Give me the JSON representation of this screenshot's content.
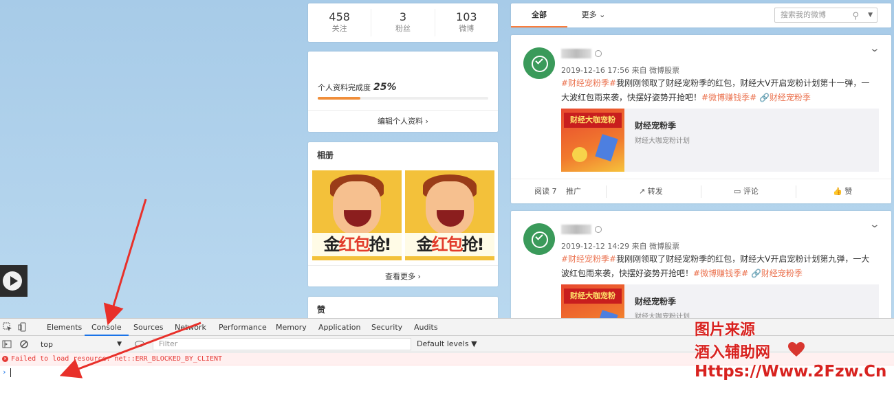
{
  "stats": [
    {
      "value": "458",
      "label": "关注"
    },
    {
      "value": "3",
      "label": "粉丝"
    },
    {
      "value": "103",
      "label": "微博"
    }
  ],
  "profile": {
    "completion_label": "个人资料完成度",
    "completion_value": "25%",
    "completion_fraction": 0.25,
    "edit_link": "编辑个人资料 ›"
  },
  "album": {
    "title": "相册",
    "photo_text_a": "金",
    "photo_text_red": "红包",
    "photo_text_b": "抢!",
    "more_link": "查看更多 ›"
  },
  "likes": {
    "title": "赞"
  },
  "feed": {
    "tabs": {
      "all": "全部",
      "more": "更多 ⌄"
    },
    "search_placeholder": "搜索我的微博",
    "posts": [
      {
        "meta": "2019-12-16 17:56 来自 微博股票",
        "topic1": "#财经宠粉季#",
        "text1": "我刚刚领取了财经宠粉季的红包，财经大V开启宠粉计划第十一弹，一大波红包雨来袭，快摆好姿势开抢吧！",
        "topic2": "#微博赚钱季#",
        "link": "财经宠粉季",
        "card_title": "财经宠粉季",
        "card_sub": "财经大咖宠粉计划",
        "card_banner": "财经大咖宠粉",
        "reads": "阅读 7",
        "promote": "推广",
        "repost": "转发",
        "comment": "评论",
        "like": "赞"
      },
      {
        "meta": "2019-12-12 14:29 来自 微博股票",
        "topic1": "#财经宠粉季#",
        "text1": "我刚刚领取了财经宠粉季的红包，财经大V开启宠粉计划第九弹，一大波红包雨来袭，快摆好姿势开抢吧！",
        "topic2": "#微博赚钱季#",
        "link": "财经宠粉季",
        "card_title": "财经宠粉季",
        "card_sub": "财经大咖宠粉计划",
        "card_banner": "财经大咖宠粉"
      }
    ]
  },
  "devtools": {
    "tabs": [
      "Elements",
      "Console",
      "Sources",
      "Network",
      "Performance",
      "Memory",
      "Application",
      "Security",
      "Audits"
    ],
    "active_tab": "Console",
    "context": "top",
    "filter_placeholder": "Filter",
    "levels": "Default levels ▼",
    "error": "Failed to load resource: net::ERR_BLOCKED_BY_CLIENT",
    "prompt": "›"
  },
  "watermark": {
    "line1": "图片来源",
    "line2": "酒入辅助网",
    "line3": "Https://Www.2Fzw.Cn"
  },
  "colors": {
    "accent": "#fa7d3c",
    "topic": "#eb7350",
    "devtools_active": "#1a73e8",
    "error": "#e53935",
    "watermark": "#d8221f"
  }
}
